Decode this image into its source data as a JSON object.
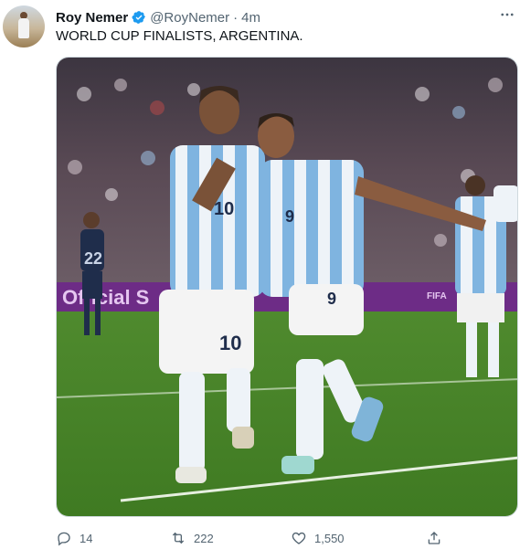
{
  "tweet": {
    "author": {
      "name": "Roy Nemer",
      "handle": "@RoyNemer",
      "verified_icon": "verified-badge-icon"
    },
    "separator": "·",
    "time": "4m",
    "text": "WORLD CUP FINALISTS, ARGENTINA.",
    "media": {
      "type": "photo",
      "banner_text": "Official S",
      "banner_text_right": "FIFA",
      "jersey_numbers": [
        "10",
        "9",
        "22"
      ]
    },
    "actions": {
      "reply_count": "14",
      "retweet_count": "222",
      "like_count": "1,550"
    },
    "colors": {
      "accent": "#1d9bf0",
      "muted": "#536471",
      "text": "#0f1419"
    }
  }
}
